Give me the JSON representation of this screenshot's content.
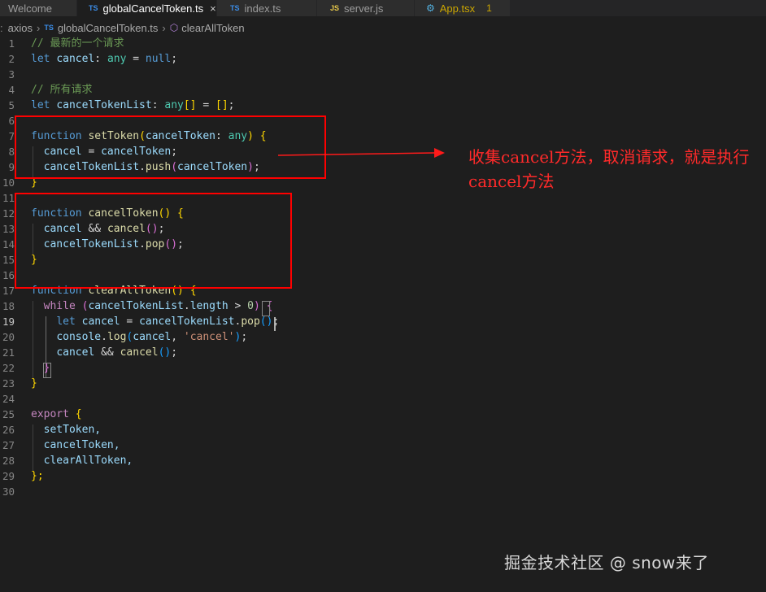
{
  "tabs": [
    {
      "label": "Welcome",
      "icon": ""
    },
    {
      "label": "globalCancelToken.ts",
      "icon": "TS",
      "close": "×"
    },
    {
      "label": "index.ts",
      "icon": "TS"
    },
    {
      "label": "server.js",
      "icon": "JS"
    },
    {
      "label": "App.tsx",
      "icon": "⚙",
      "badge": "1"
    }
  ],
  "breadcrumb": {
    "root": "axios",
    "file_icon": "TS",
    "file": "globalCancelToken.ts",
    "symbol_icon": "cube-icon",
    "symbol": "clearAllToken"
  },
  "line_numbers": [
    "1",
    "2",
    "3",
    "4",
    "5",
    "6",
    "7",
    "8",
    "9",
    "10",
    "11",
    "12",
    "13",
    "14",
    "15",
    "16",
    "17",
    "18",
    "19",
    "20",
    "21",
    "22",
    "23",
    "24",
    "25",
    "26",
    "27",
    "28",
    "29",
    "30"
  ],
  "current_line": "19",
  "code": {
    "l1_comment": "// 最新的一个请求",
    "l2": [
      "let",
      "cancel",
      ":",
      "any",
      "=",
      "null",
      ";"
    ],
    "l4_comment": "// 所有请求",
    "l5": [
      "let",
      "cancelTokenList",
      ":",
      "any",
      "[]",
      "=",
      "[]",
      ";"
    ],
    "l7": [
      "function",
      "setToken",
      "(",
      "cancelToken",
      ":",
      "any",
      ")",
      "{"
    ],
    "l8": [
      "cancel",
      "=",
      "cancelToken",
      ";"
    ],
    "l9": [
      "cancelTokenList",
      ".",
      "push",
      "(",
      "cancelToken",
      ")",
      ";"
    ],
    "l10": "}",
    "l12": [
      "function",
      "cancelToken",
      "()",
      "{"
    ],
    "l13": [
      "cancel",
      "&&",
      "cancel",
      "()",
      ";"
    ],
    "l14": [
      "cancelTokenList",
      ".",
      "pop",
      "()",
      ";"
    ],
    "l15": "}",
    "l17": [
      "function",
      "clearAllToken",
      "()",
      "{"
    ],
    "l18": [
      "while",
      "(",
      "cancelTokenList",
      ".",
      "length",
      ">",
      "0",
      ")",
      "{"
    ],
    "l19": [
      "let",
      "cancel",
      "=",
      "cancelTokenList",
      ".",
      "pop",
      "()",
      ";"
    ],
    "l20": [
      "console",
      ".",
      "log",
      "(",
      "cancel",
      ",",
      "'cancel'",
      ")",
      ";"
    ],
    "l21": [
      "cancel",
      "&&",
      "cancel",
      "()",
      ";"
    ],
    "l22": "}",
    "l23": "}",
    "l25": [
      "export",
      "{"
    ],
    "l26": "setToken,",
    "l27": "cancelToken,",
    "l28": "clearAllToken,",
    "l29": "};"
  },
  "annotation": "收集cancel方法，取消请求，就是执行cancel方法",
  "watermark": "掘金技术社区 @ snow来了",
  "colors": {
    "annotation": "#ff2a2a",
    "keyword": "#569cd6",
    "function": "#dcdcaa",
    "variable": "#9cdcfe"
  }
}
